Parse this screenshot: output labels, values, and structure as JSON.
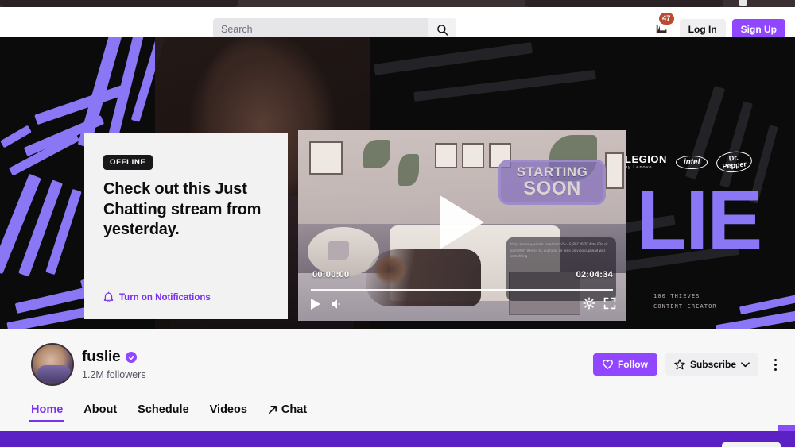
{
  "topnav": {
    "search": {
      "placeholder": "Search",
      "value": "",
      "icon": "search-icon"
    },
    "prime": {
      "icon": "prime-loot-icon",
      "badge_count": "47"
    },
    "login_label": "Log In",
    "signup_label": "Sign Up"
  },
  "hero": {
    "banner_text": "LIE",
    "sponsors": [
      {
        "name": "LEGION",
        "sub": "by Lenovo"
      },
      {
        "name": "intel"
      },
      {
        "name": "Dr Pepper",
        "line1": "Dr.",
        "line2": "Pepper"
      }
    ],
    "creator_tag_line1": "100 THIEVES",
    "creator_tag_line2": "CONTENT CREATOR"
  },
  "offline_card": {
    "badge": "OFFLINE",
    "headline": "Check out this Just Chatting stream from yesterday.",
    "notification_label": "Turn on Notifications",
    "notification_icon": "bell-icon"
  },
  "player": {
    "overlay_line1": "STARTING",
    "overlay_line2": "SOON",
    "current_time": "00:00:00",
    "duration": "02:04:34",
    "progress_percent": 0,
    "big_play_icon": "play-icon",
    "controls": {
      "play_icon": "play-icon",
      "volume_icon": "volume-icon",
      "settings_icon": "gear-icon",
      "fullscreen_icon": "fullscreen-icon"
    },
    "chat_overlay_text": "https://www.youtube.com/watch? v=S_REC26i70  Azte 92e sit Sam  Matt  92e sit 4C cuphead ae lesle playing cuphead was something"
  },
  "channel": {
    "name": "fuslie",
    "verified": true,
    "verified_icon": "verified-check-icon",
    "followers": "1.2M followers",
    "avatar_icon": "avatar",
    "follow_label": "Follow",
    "follow_icon": "heart-icon",
    "subscribe_label": "Subscribe",
    "subscribe_icon": "star-icon",
    "subscribe_chevron_icon": "chevron-down-icon",
    "more_icon": "kebab-menu-icon"
  },
  "tabs": [
    {
      "label": "Home",
      "active": true
    },
    {
      "label": "About",
      "active": false
    },
    {
      "label": "Schedule",
      "active": false
    },
    {
      "label": "Videos",
      "active": false
    },
    {
      "label": "Chat",
      "active": false,
      "icon": "external-link-icon"
    }
  ],
  "colors": {
    "accent_purple": "#9147ff",
    "link_purple": "#7b2ff2",
    "banner_purple": "#8a77f5",
    "badge_red": "#bb4a32",
    "bottom_strip": "#5b21c4",
    "page_bg": "#f7f7f8",
    "hero_bg": "#0b0b0b"
  }
}
